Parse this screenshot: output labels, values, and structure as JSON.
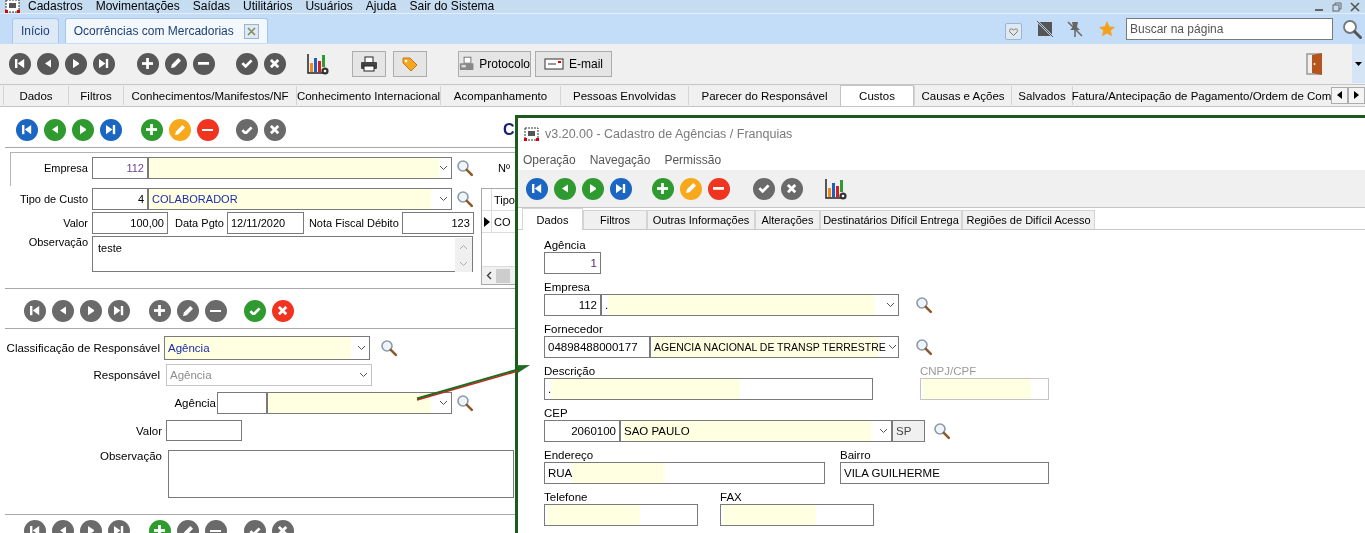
{
  "menu_bar": {
    "items": [
      "Cadastros",
      "Movimentações",
      "Saídas",
      "Utilitários",
      "Usuários",
      "Ajuda",
      "Sair do Sistema"
    ]
  },
  "page_tabs": [
    {
      "label": "Início",
      "selected": false,
      "closable": false
    },
    {
      "label": "Ocorrências com Mercadorias",
      "selected": true,
      "closable": true
    }
  ],
  "page_search": {
    "placeholder": "Buscar na página"
  },
  "main_toolbar": {
    "record_buttons": [
      {
        "enabled": false
      },
      {
        "enabled": false
      },
      {
        "enabled": false
      },
      {
        "enabled": false
      },
      {
        "enabled": false
      },
      {
        "enabled": false
      },
      {
        "enabled": false
      },
      {
        "enabled": false
      },
      {
        "enabled": false
      }
    ],
    "buttons": [
      "Protocolo",
      "E-mail"
    ]
  },
  "section_tabs": [
    {
      "label": "Dados",
      "selected": false
    },
    {
      "label": "Filtros",
      "selected": false
    },
    {
      "label": "Conhecimentos/Manifestos/NF",
      "selected": false
    },
    {
      "label": "Conhecimento Internacional",
      "selected": false
    },
    {
      "label": "Acompanhamento",
      "selected": false
    },
    {
      "label": "Pessoas Envolvidas",
      "selected": false
    },
    {
      "label": "Parecer do Responsável",
      "selected": false
    },
    {
      "label": "Custos",
      "selected": true
    },
    {
      "label": "Causas e Ações",
      "selected": false
    },
    {
      "label": "Salvados",
      "selected": false
    },
    {
      "label": "Fatura/Antecipação de Pagamento/Ordem de Com",
      "selected": false
    }
  ],
  "cost_form": {
    "toolbar": [
      {
        "enabled": true
      },
      {
        "enabled": true
      },
      {
        "enabled": true
      },
      {
        "enabled": true
      },
      {
        "enabled": true
      },
      {
        "enabled": true
      },
      {
        "enabled": true
      },
      {
        "enabled": false
      },
      {
        "enabled": false
      }
    ],
    "title": "C",
    "empresa": {
      "label": "Empresa",
      "code": "112"
    },
    "number_label": "Nº",
    "tipo_custo": {
      "label": "Tipo de Custo",
      "code": "4",
      "value": "COLABORADOR"
    },
    "valor": {
      "label": "Valor",
      "value": "100,00"
    },
    "data_pgto": {
      "label": "Data Pgto",
      "value": "12/11/2020"
    },
    "nota_fiscal": {
      "label": "Nota Fiscal Débito",
      "value": "123"
    },
    "observacao": {
      "label": "Observação",
      "value": "teste"
    },
    "grid": {
      "columns": [
        "Tipo"
      ],
      "rows": [
        {
          "cells": [
            "CO"
          ],
          "selected": true
        }
      ]
    }
  },
  "responsible_form": {
    "toolbar": [
      {
        "enabled": false
      },
      {
        "enabled": false
      },
      {
        "enabled": false
      },
      {
        "enabled": false
      },
      {
        "enabled": false
      },
      {
        "enabled": false
      },
      {
        "enabled": false
      },
      {
        "enabled": true
      },
      {
        "enabled": true
      }
    ],
    "classificacao": {
      "label": "Classificação de Responsável",
      "value": "Agência"
    },
    "responsavel": {
      "label": "Responsável",
      "value": "Agência",
      "disabled": true
    },
    "agencia": {
      "label": "Agência"
    },
    "valor": {
      "label": "Valor"
    },
    "observacao": {
      "label": "Observação"
    },
    "next_toolbar": [
      {
        "enabled": false
      },
      {
        "enabled": false
      },
      {
        "enabled": false
      },
      {
        "enabled": false
      },
      {
        "enabled": true
      },
      {
        "enabled": false
      },
      {
        "enabled": false
      },
      {
        "enabled": false
      },
      {
        "enabled": false
      }
    ]
  },
  "dialog": {
    "title": "v3.20.00 - Cadastro de Agências / Franquias",
    "menu": [
      "Operação",
      "Navegação",
      "Permissão"
    ],
    "toolbar": [
      {
        "enabled": true
      },
      {
        "enabled": true
      },
      {
        "enabled": true
      },
      {
        "enabled": true
      },
      {
        "enabled": true
      },
      {
        "enabled": true
      },
      {
        "enabled": true
      },
      {
        "enabled": false
      },
      {
        "enabled": false
      }
    ],
    "tabs": [
      {
        "label": "Dados",
        "selected": true
      },
      {
        "label": "Filtros",
        "selected": false
      },
      {
        "label": "Outras Informações",
        "selected": false
      },
      {
        "label": "Alterações",
        "selected": false
      },
      {
        "label": "Destinatários Difícil Entrega",
        "selected": false
      },
      {
        "label": "Regiões de Difícil Acesso",
        "selected": false
      }
    ],
    "agencia": {
      "label": "Agência",
      "value": "1"
    },
    "empresa": {
      "label": "Empresa",
      "code": "112",
      "value": "."
    },
    "fornecedor": {
      "label": "Fornecedor",
      "code": "04898488000177",
      "value": "AGENCIA NACIONAL DE TRANSP TERRESTRE"
    },
    "descricao": {
      "label": "Descrição",
      "value": "."
    },
    "cnpj": {
      "label": "CNPJ/CPF",
      "disabled": true
    },
    "cep": {
      "label": "CEP",
      "code": "2060100",
      "value": "SAO PAULO",
      "uf": "SP"
    },
    "endereco": {
      "label": "Endereço",
      "value": "RUA"
    },
    "bairro": {
      "label": "Bairro",
      "value": "VILA GUILHERME"
    },
    "telefone": {
      "label": "Telefone"
    },
    "fax": {
      "label": "FAX"
    }
  }
}
